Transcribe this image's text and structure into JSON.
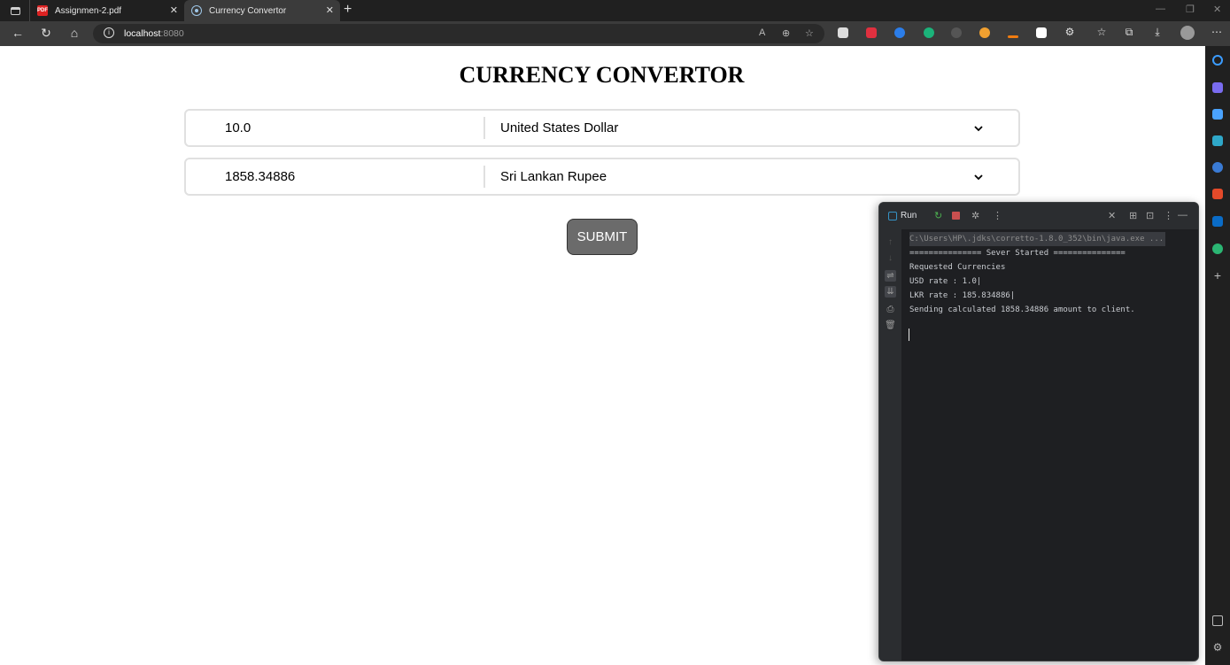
{
  "browser": {
    "tabs": [
      {
        "title": "Assignmen-2.pdf",
        "active": false
      },
      {
        "title": "Currency Convertor",
        "active": true
      }
    ],
    "address": {
      "host": "localhost",
      "port": ":8080"
    }
  },
  "page": {
    "title": "CURRENCY CONVERTOR",
    "from": {
      "amount": "10.0",
      "currency": "United States Dollar"
    },
    "to": {
      "amount": "1858.34886",
      "currency": "Sri Lankan Rupee"
    },
    "submit_label": "SUBMIT"
  },
  "run_window": {
    "title": "Run",
    "lines": [
      "C:\\Users\\HP\\.jdks\\corretto-1.8.0_352\\bin\\java.exe ...",
      "=============== Sever Started ===============",
      "Requested Currencies",
      "USD rate : 1.0|",
      "LKR rate : 185.834886|",
      "Sending calculated 1858.34886 amount to client."
    ]
  },
  "colors": {
    "submit_bg": "#6b6b6b",
    "border": "#e0e0e0",
    "console_bg": "#1e1f22"
  }
}
